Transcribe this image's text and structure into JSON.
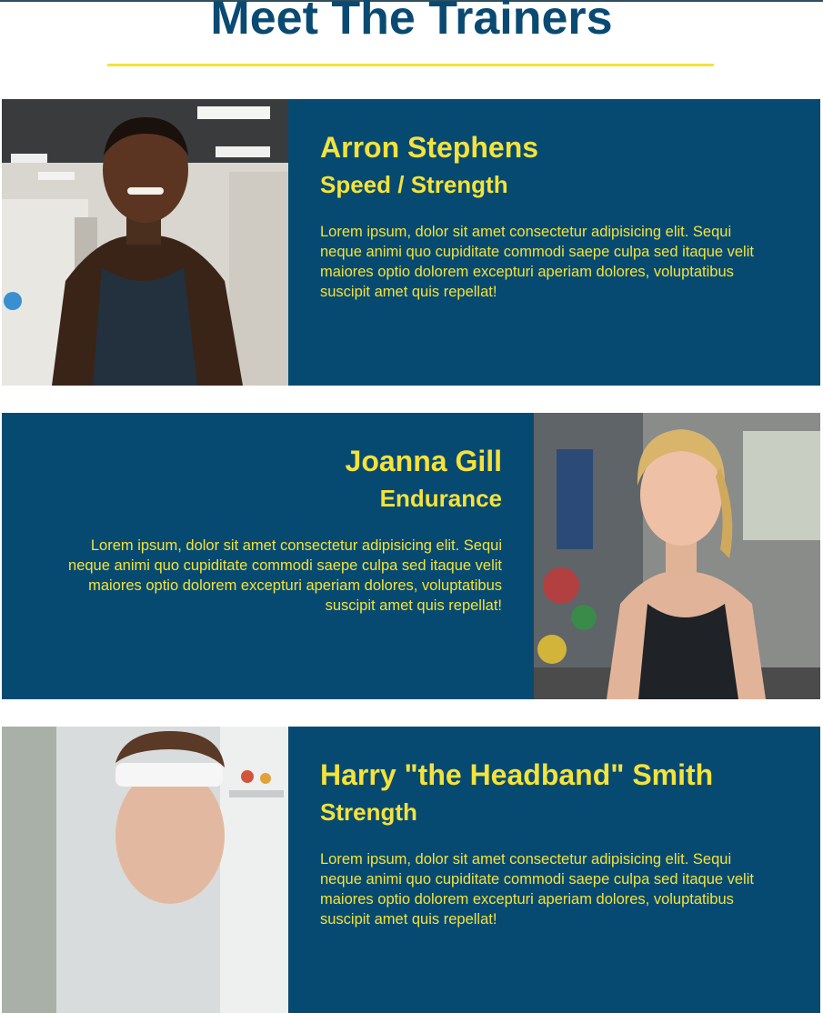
{
  "page": {
    "title": "Meet The Trainers"
  },
  "colors": {
    "accent": "#f5e23a",
    "card_bg": "#064a72",
    "title": "#0a4a72"
  },
  "trainers": [
    {
      "name": "Arron Stephens",
      "specialty": "Speed / Strength",
      "bio": "Lorem ipsum, dolor sit amet consectetur adipisicing elit. Sequi neque animi quo cupiditate commodi saepe culpa sed itaque velit maiores optio dolorem excepturi aperiam dolores, voluptatibus suscipit amet quis repellat!"
    },
    {
      "name": "Joanna Gill",
      "specialty": "Endurance",
      "bio": "Lorem ipsum, dolor sit amet consectetur adipisicing elit. Sequi neque animi quo cupiditate commodi saepe culpa sed itaque velit maiores optio dolorem excepturi aperiam dolores, voluptatibus suscipit amet quis repellat!"
    },
    {
      "name": "Harry \"the Headband\" Smith",
      "specialty": "Strength",
      "bio": "Lorem ipsum, dolor sit amet consectetur adipisicing elit. Sequi neque animi quo cupiditate commodi saepe culpa sed itaque velit maiores optio dolorem excepturi aperiam dolores, voluptatibus suscipit amet quis repellat!"
    }
  ]
}
